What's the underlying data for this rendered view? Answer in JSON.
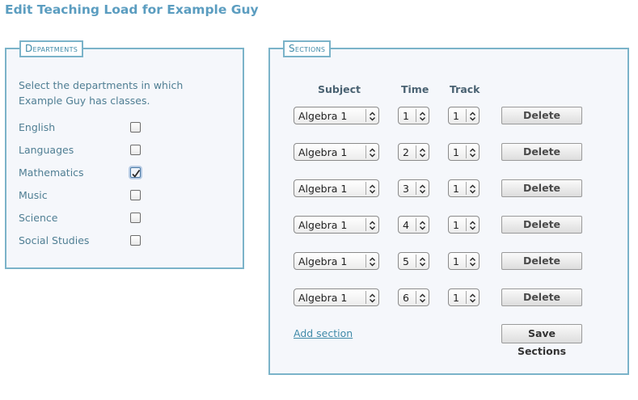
{
  "page": {
    "title": "Edit Teaching Load for Example Guy"
  },
  "departments": {
    "legend": "Departments",
    "intro": "Select the departments in which Example Guy has classes.",
    "items": [
      {
        "label": "English",
        "checked": false
      },
      {
        "label": "Languages",
        "checked": false
      },
      {
        "label": "Mathematics",
        "checked": true
      },
      {
        "label": "Music",
        "checked": false
      },
      {
        "label": "Science",
        "checked": false
      },
      {
        "label": "Social Studies",
        "checked": false
      }
    ]
  },
  "sections": {
    "legend": "Sections",
    "headers": {
      "subject": "Subject",
      "time": "Time",
      "track": "Track"
    },
    "rows": [
      {
        "subject": "Algebra 1",
        "time": "1",
        "track": "1",
        "delete_label": "Delete"
      },
      {
        "subject": "Algebra 1",
        "time": "2",
        "track": "1",
        "delete_label": "Delete"
      },
      {
        "subject": "Algebra 1",
        "time": "3",
        "track": "1",
        "delete_label": "Delete"
      },
      {
        "subject": "Algebra 1",
        "time": "4",
        "track": "1",
        "delete_label": "Delete"
      },
      {
        "subject": "Algebra 1",
        "time": "5",
        "track": "1",
        "delete_label": "Delete"
      },
      {
        "subject": "Algebra 1",
        "time": "6",
        "track": "1",
        "delete_label": "Delete"
      }
    ],
    "add_label": "Add section",
    "save_label": "Save Sections"
  },
  "colors": {
    "accent": "#5b9dc0",
    "border": "#7bb3c9",
    "panel_bg": "#f5f7fb"
  }
}
